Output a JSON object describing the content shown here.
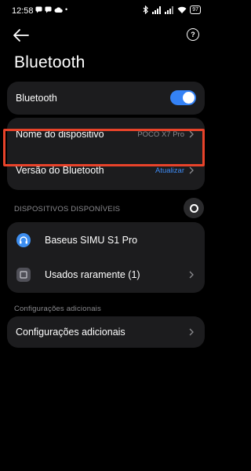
{
  "status_bar": {
    "time": "12:58",
    "battery": "97"
  },
  "page": {
    "title": "Bluetooth"
  },
  "settings": {
    "bluetooth_label": "Bluetooth",
    "bluetooth_enabled": true,
    "device_name_label": "Nome do dispositivo",
    "device_name_value": "POCO X7 Pro",
    "bt_version_label": "Versão do Bluetooth",
    "bt_version_action": "Atualizar"
  },
  "available_devices": {
    "header": "DISPOSITIVOS DISPONÍVEIS",
    "items": [
      {
        "name": "Baseus SIMU S1 Pro",
        "icon": "headphones-icon"
      },
      {
        "name": "Usados raramente (1)",
        "icon": "device-icon"
      }
    ]
  },
  "additional": {
    "header": "Configurações adicionais",
    "item_label": "Configurações adicionais"
  },
  "colors": {
    "accent": "#3482f6",
    "highlight": "#e8432a",
    "card": "#1c1c1e"
  }
}
